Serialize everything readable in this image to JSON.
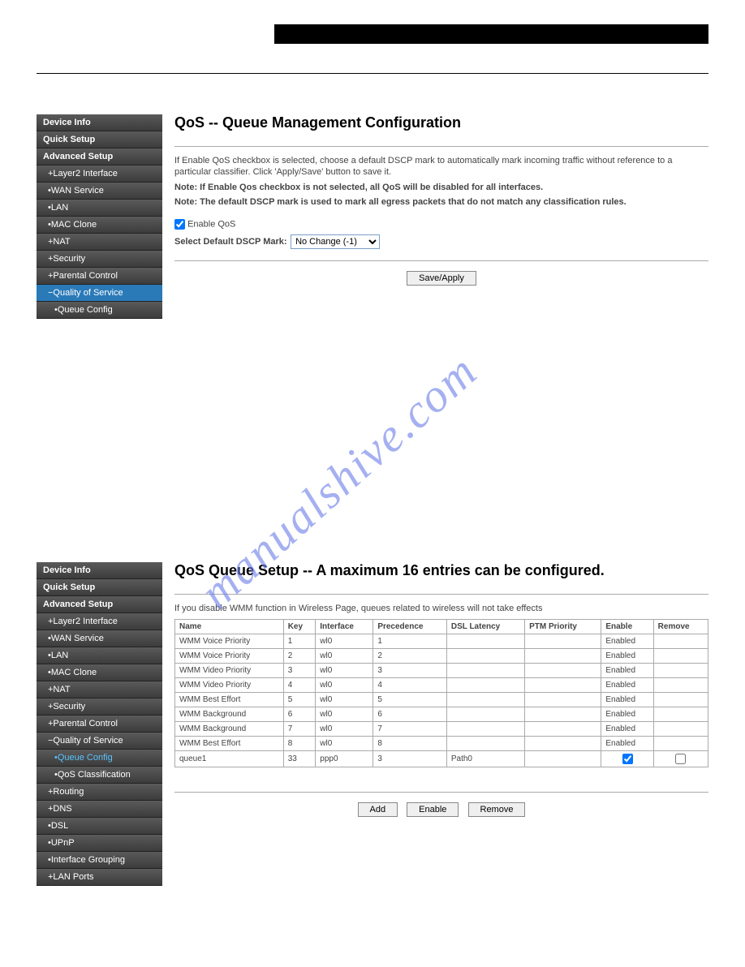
{
  "section1": {
    "sidebar": [
      {
        "label": "Device Info",
        "cls": ""
      },
      {
        "label": "Quick Setup",
        "cls": ""
      },
      {
        "label": "Advanced Setup",
        "cls": ""
      },
      {
        "label": "+Layer2 Interface",
        "cls": "sub"
      },
      {
        "label": "•WAN Service",
        "cls": "sub"
      },
      {
        "label": "•LAN",
        "cls": "sub"
      },
      {
        "label": "•MAC Clone",
        "cls": "sub"
      },
      {
        "label": "+NAT",
        "cls": "sub"
      },
      {
        "label": "+Security",
        "cls": "sub"
      },
      {
        "label": "+Parental Control",
        "cls": "sub"
      },
      {
        "label": "−Quality of Service",
        "cls": "sub active-blue"
      },
      {
        "label": "•Queue Config",
        "cls": "sub2"
      }
    ],
    "title": "QoS -- Queue Management Configuration",
    "desc": "If Enable QoS checkbox is selected, choose a default DSCP mark to automatically mark incoming traffic without reference to a particular classifier. Click 'Apply/Save' button to save it.",
    "note1": "Note: If Enable Qos checkbox is not selected, all QoS will be disabled for all interfaces.",
    "note2": "Note: The default DSCP mark is used to mark all egress packets that do not match any classification rules.",
    "enable_label": "Enable QoS",
    "select_label": "Select Default DSCP Mark:",
    "select_value": "No Change (-1)",
    "save_btn": "Save/Apply"
  },
  "section2": {
    "sidebar": [
      {
        "label": "Device Info",
        "cls": ""
      },
      {
        "label": "Quick Setup",
        "cls": ""
      },
      {
        "label": "Advanced Setup",
        "cls": ""
      },
      {
        "label": "+Layer2 Interface",
        "cls": "sub"
      },
      {
        "label": "•WAN Service",
        "cls": "sub"
      },
      {
        "label": "•LAN",
        "cls": "sub"
      },
      {
        "label": "•MAC Clone",
        "cls": "sub"
      },
      {
        "label": "+NAT",
        "cls": "sub"
      },
      {
        "label": "+Security",
        "cls": "sub"
      },
      {
        "label": "+Parental Control",
        "cls": "sub"
      },
      {
        "label": "−Quality of Service",
        "cls": "sub"
      },
      {
        "label": "•Queue Config",
        "cls": "sub2 active-text"
      },
      {
        "label": "•QoS Classification",
        "cls": "sub2"
      },
      {
        "label": "+Routing",
        "cls": "sub"
      },
      {
        "label": "+DNS",
        "cls": "sub"
      },
      {
        "label": "•DSL",
        "cls": "sub"
      },
      {
        "label": "•UPnP",
        "cls": "sub"
      },
      {
        "label": "•Interface Grouping",
        "cls": "sub"
      },
      {
        "label": "+LAN Ports",
        "cls": "sub"
      }
    ],
    "title": "QoS Queue Setup -- A maximum 16 entries can be configured.",
    "note": "If you disable WMM function in Wireless Page, queues related to wireless will not take effects",
    "headers": [
      "Name",
      "Key",
      "Interface",
      "Precedence",
      "DSL Latency",
      "PTM Priority",
      "Enable",
      "Remove"
    ],
    "rows": [
      {
        "name": "WMM Voice Priority",
        "key": "1",
        "iface": "wl0",
        "prec": "1",
        "dsl": "",
        "ptm": "",
        "enable": "Enabled",
        "remove": ""
      },
      {
        "name": "WMM Voice Priority",
        "key": "2",
        "iface": "wl0",
        "prec": "2",
        "dsl": "",
        "ptm": "",
        "enable": "Enabled",
        "remove": ""
      },
      {
        "name": "WMM Video Priority",
        "key": "3",
        "iface": "wl0",
        "prec": "3",
        "dsl": "",
        "ptm": "",
        "enable": "Enabled",
        "remove": ""
      },
      {
        "name": "WMM Video Priority",
        "key": "4",
        "iface": "wl0",
        "prec": "4",
        "dsl": "",
        "ptm": "",
        "enable": "Enabled",
        "remove": ""
      },
      {
        "name": "WMM Best Effort",
        "key": "5",
        "iface": "wl0",
        "prec": "5",
        "dsl": "",
        "ptm": "",
        "enable": "Enabled",
        "remove": ""
      },
      {
        "name": "WMM Background",
        "key": "6",
        "iface": "wl0",
        "prec": "6",
        "dsl": "",
        "ptm": "",
        "enable": "Enabled",
        "remove": ""
      },
      {
        "name": "WMM Background",
        "key": "7",
        "iface": "wl0",
        "prec": "7",
        "dsl": "",
        "ptm": "",
        "enable": "Enabled",
        "remove": ""
      },
      {
        "name": "WMM Best Effort",
        "key": "8",
        "iface": "wl0",
        "prec": "8",
        "dsl": "",
        "ptm": "",
        "enable": "Enabled",
        "remove": ""
      },
      {
        "name": "queue1",
        "key": "33",
        "iface": "ppp0",
        "prec": "3",
        "dsl": "Path0",
        "ptm": "",
        "enable": "checkbox-checked",
        "remove": "checkbox"
      }
    ],
    "buttons": {
      "add": "Add",
      "enable": "Enable",
      "remove": "Remove"
    }
  },
  "watermark": "manualshive.com"
}
